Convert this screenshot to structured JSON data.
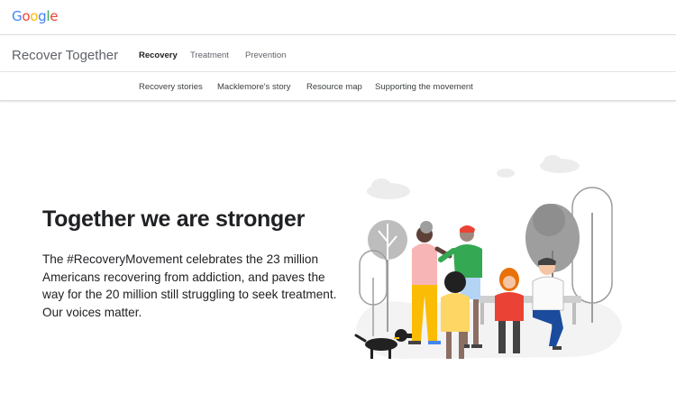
{
  "brand": {
    "letters": [
      {
        "char": "G",
        "color": "#4285F4"
      },
      {
        "char": "o",
        "color": "#EA4335"
      },
      {
        "char": "o",
        "color": "#FBBC05"
      },
      {
        "char": "g",
        "color": "#4285F4"
      },
      {
        "char": "l",
        "color": "#34A853"
      },
      {
        "char": "e",
        "color": "#EA4335"
      }
    ]
  },
  "site": {
    "title": "Recover Together"
  },
  "main_nav": [
    "Recovery",
    "Treatment",
    "Prevention"
  ],
  "main_nav_active": "Recovery",
  "sub_nav": [
    "Recovery stories",
    "Macklemore's story",
    "Resource map",
    "Supporting the movement"
  ],
  "hero": {
    "title": "Together we are stronger",
    "body": "The #RecoveryMovement celebrates the 23 million Americans recovering from addiction, and paves the way for the 20 million still struggling to seek treatment. Our voices matter."
  },
  "colors": {
    "text": "#202124",
    "muted": "#5f6368",
    "divider": "#dadce0",
    "illustration_gray": "#bdbdbd",
    "accent_yellow": "#FBBC05",
    "accent_red": "#EA4335",
    "accent_green": "#34A853",
    "accent_blue": "#4285F4"
  }
}
